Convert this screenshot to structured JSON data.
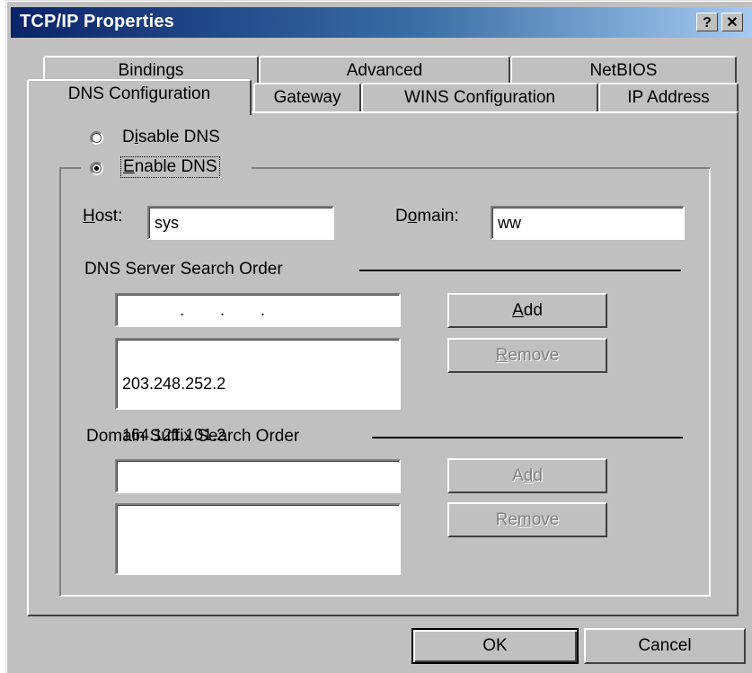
{
  "window": {
    "title": "TCP/IP Properties",
    "help_button": "?",
    "close_button": "✕"
  },
  "tabs_back": [
    {
      "label": "Bindings"
    },
    {
      "label": "Advanced"
    },
    {
      "label": "NetBIOS"
    }
  ],
  "tabs_front": [
    {
      "label": "DNS Configuration",
      "active": true
    },
    {
      "label": "Gateway"
    },
    {
      "label": "WINS Configuration"
    },
    {
      "label": "IP Address"
    }
  ],
  "dns": {
    "disable_label_pre": "D",
    "disable_label_u": "i",
    "disable_label_post": "sable DNS",
    "enable_label_u": "E",
    "enable_label_post": "nable DNS",
    "selected": "enable",
    "host_label_u": "H",
    "host_label_post": "ost:",
    "host_value": "sys",
    "domain_label_pre": "D",
    "domain_label_u": "o",
    "domain_label_post": "main:",
    "domain_value": "ww",
    "server_section_label": "DNS Server Search Order",
    "server_input_value": ".        .        .",
    "server_list": [
      "203.248.252.2",
      "164.121.101.2"
    ],
    "server_add_u": "A",
    "server_add_post": "dd",
    "server_remove_u": "R",
    "server_remove_post": "emove",
    "suffix_section_label": "Domain Suffix Search Order",
    "suffix_input_value": "",
    "suffix_list": [],
    "suffix_add_pre": "A",
    "suffix_add_u": "d",
    "suffix_add_post": "d",
    "suffix_remove_pre": "Re",
    "suffix_remove_u": "m",
    "suffix_remove_post": "ove"
  },
  "footer": {
    "ok_label": "OK",
    "cancel_label": "Cancel"
  }
}
